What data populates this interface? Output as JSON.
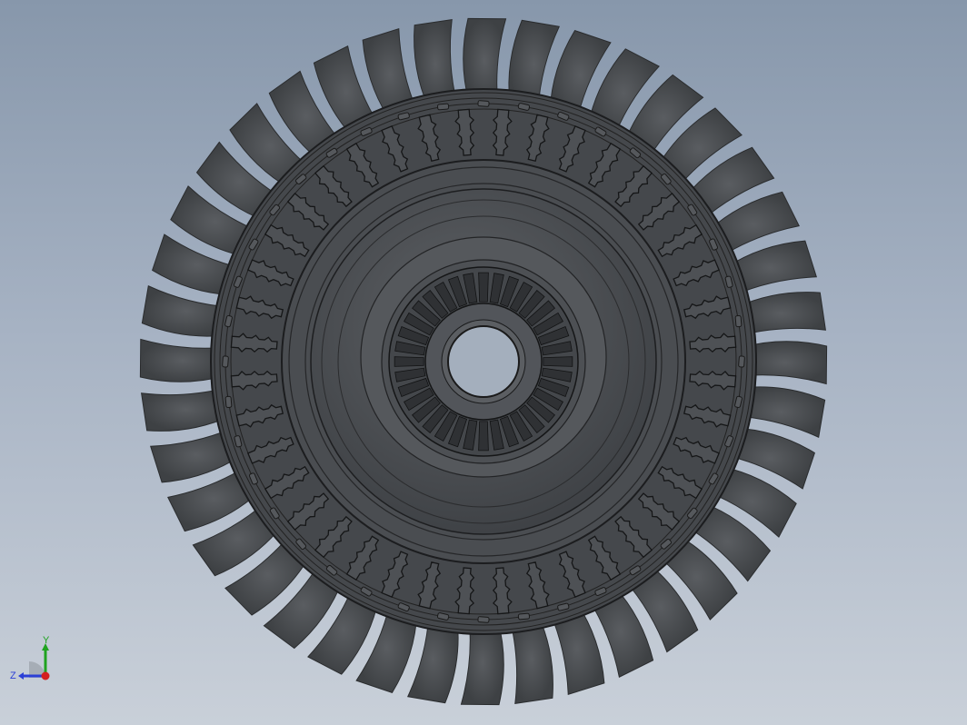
{
  "viewport": {
    "background_top": "#8797ab",
    "background_bottom": "#c9d0d9",
    "model_color": "#4c4f53"
  },
  "model": {
    "name": "turbine-disk-with-blades",
    "blade_count": 40,
    "fir_tree_slot_count": 40,
    "inner_spline_count": 36
  },
  "triad": {
    "axis_y_label": "Y",
    "axis_z_label": "Z",
    "y_color": "#1fa31f",
    "z_color": "#2b3fd6",
    "x_color": "#d42020"
  }
}
